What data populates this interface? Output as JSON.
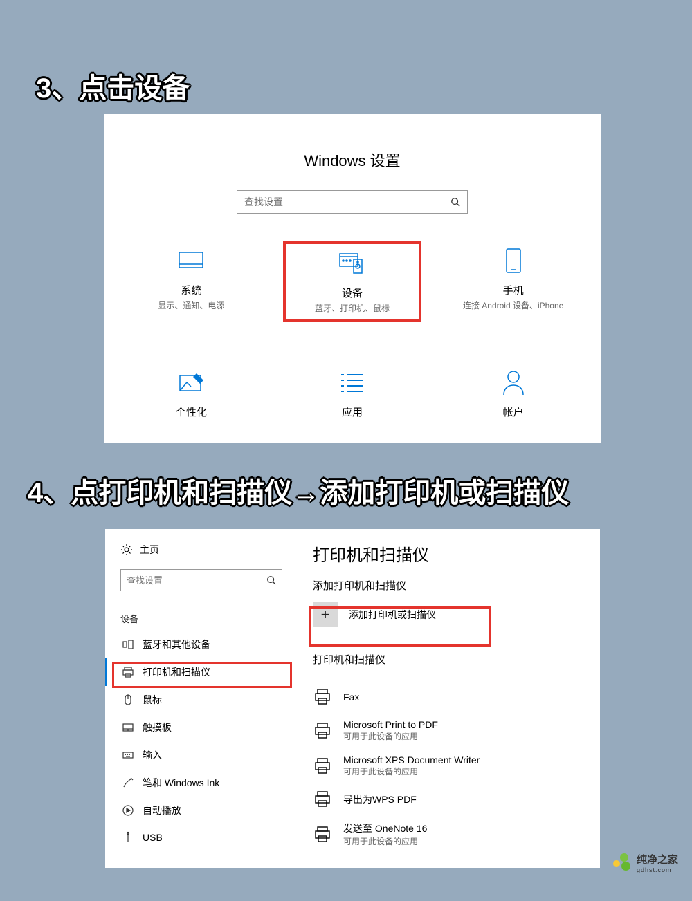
{
  "steps": {
    "s3": "3、点击设备",
    "s4": "4、点打印机和扫描仪→添加打印机或扫描仪"
  },
  "settings": {
    "title": "Windows 设置",
    "search_placeholder": "查找设置",
    "tiles": {
      "system": {
        "title": "系统",
        "desc": "显示、通知、电源"
      },
      "devices": {
        "title": "设备",
        "desc": "蓝牙、打印机、鼠标"
      },
      "phone": {
        "title": "手机",
        "desc": "连接 Android 设备、iPhone"
      },
      "personalize": {
        "title": "个性化"
      },
      "apps": {
        "title": "应用"
      },
      "accounts": {
        "title": "帐户"
      }
    }
  },
  "printers": {
    "home": "主页",
    "search_placeholder": "查找设置",
    "section": "设备",
    "nav": {
      "bluetooth": "蓝牙和其他设备",
      "printers": "打印机和扫描仪",
      "mouse": "鼠标",
      "touchpad": "触摸板",
      "input": "输入",
      "pen": "笔和 Windows Ink",
      "autoplay": "自动播放",
      "usb": "USB"
    },
    "main": {
      "h1": "打印机和扫描仪",
      "add_header": "添加打印机和扫描仪",
      "add_label": "添加打印机或扫描仪",
      "list_header": "打印机和扫描仪",
      "available_apps": "可用于此设备的应用",
      "items": {
        "fax": "Fax",
        "pdf": "Microsoft Print to PDF",
        "xps": "Microsoft XPS Document Writer",
        "wps": "导出为WPS PDF",
        "onenote": "发送至 OneNote 16"
      }
    }
  },
  "watermark": {
    "name": "纯净之家",
    "domain": "gdhst.com"
  }
}
